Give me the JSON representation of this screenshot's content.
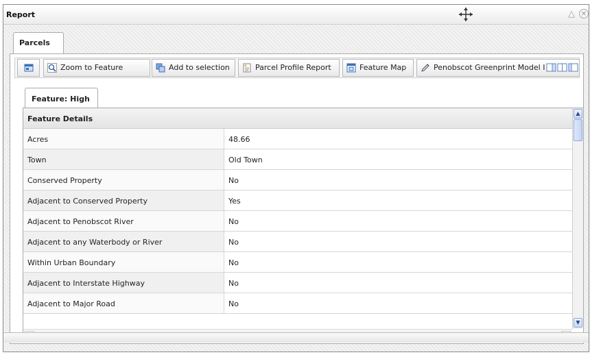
{
  "window": {
    "title": "Report"
  },
  "tabs": {
    "parcels": "Parcels",
    "feature": "Feature: High"
  },
  "toolbar": {
    "zoom": "Zoom to Feature",
    "add": "Add to selection",
    "profile": "Parcel Profile Report",
    "map": "Feature Map",
    "greenprint": "Penobscot Greenprint Model I"
  },
  "details": {
    "header": "Feature Details",
    "rows": [
      {
        "label": "Acres",
        "value": "48.66"
      },
      {
        "label": "Town",
        "value": "Old Town"
      },
      {
        "label": "Conserved Property",
        "value": "No"
      },
      {
        "label": "Adjacent to Conserved Property",
        "value": "Yes"
      },
      {
        "label": "Adjacent to Penobscot River",
        "value": "No"
      },
      {
        "label": "Adjacent to any Waterbody or River",
        "value": "No"
      },
      {
        "label": "Within Urban Boundary",
        "value": "No"
      },
      {
        "label": "Adjacent to Interstate Highway",
        "value": "No"
      },
      {
        "label": "Adjacent to Major Road",
        "value": "No"
      }
    ]
  }
}
